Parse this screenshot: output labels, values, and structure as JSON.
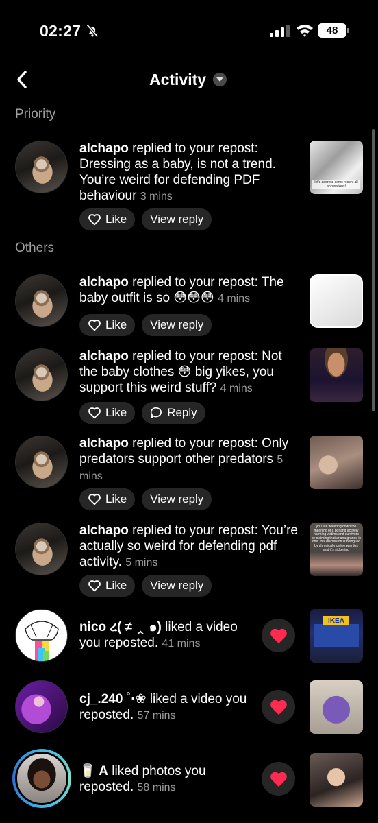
{
  "status": {
    "time": "02:27",
    "battery": "48"
  },
  "header": {
    "title": "Activity"
  },
  "sections": {
    "priority": "Priority",
    "others": "Others"
  },
  "actions": {
    "like": "Like",
    "view_reply": "View reply",
    "reply": "Reply"
  },
  "items": [
    {
      "user": "alchapo",
      "message": " replied to your repost: Dressing as a baby, is not a trend. You’re weird for defending PDF behaviour ",
      "time": "3 mins"
    },
    {
      "user": "alchapo",
      "message": " replied to your repost: The baby outfit is so 😳😳😳 ",
      "time": "4 mins"
    },
    {
      "user": "alchapo",
      "message": " replied to your repost: Not the baby clothes 😳 big yikes, you support this weird stuff? ",
      "time": "4 mins"
    },
    {
      "user": "alchapo",
      "message": " replied to your repost: Only predators support other predators ",
      "time": "5 mins"
    },
    {
      "user": "alchapo",
      "message": " replied to your repost: You’re actually so weird for defending pdf activity. ",
      "time": "5 mins"
    },
    {
      "user": "nico ረ( ≠ ‸ ๑)",
      "message": " liked a video you reposted. ",
      "time": "41 mins"
    },
    {
      "user": "cj_.240 ˚‧❀",
      "message": " liked a video you reposted. ",
      "time": "57 mins"
    },
    {
      "user": "🥛 A",
      "message": " liked photos you reposted. ",
      "time": "58 mins"
    }
  ],
  "thumbnail_text": {
    "item1": "let's address some recent all accusations!",
    "item5": "you are watering down the meaning of a pdf and actively harming victims and survivors by claiming that ariana grande is one. this discussion is being led by chronically online weirdos and it's sickening",
    "ikea": "IKEA"
  },
  "colors": {
    "background": "#000000",
    "pill": "#262626",
    "muted_text": "#9c9c9c",
    "heart": "#ff2a4f"
  }
}
